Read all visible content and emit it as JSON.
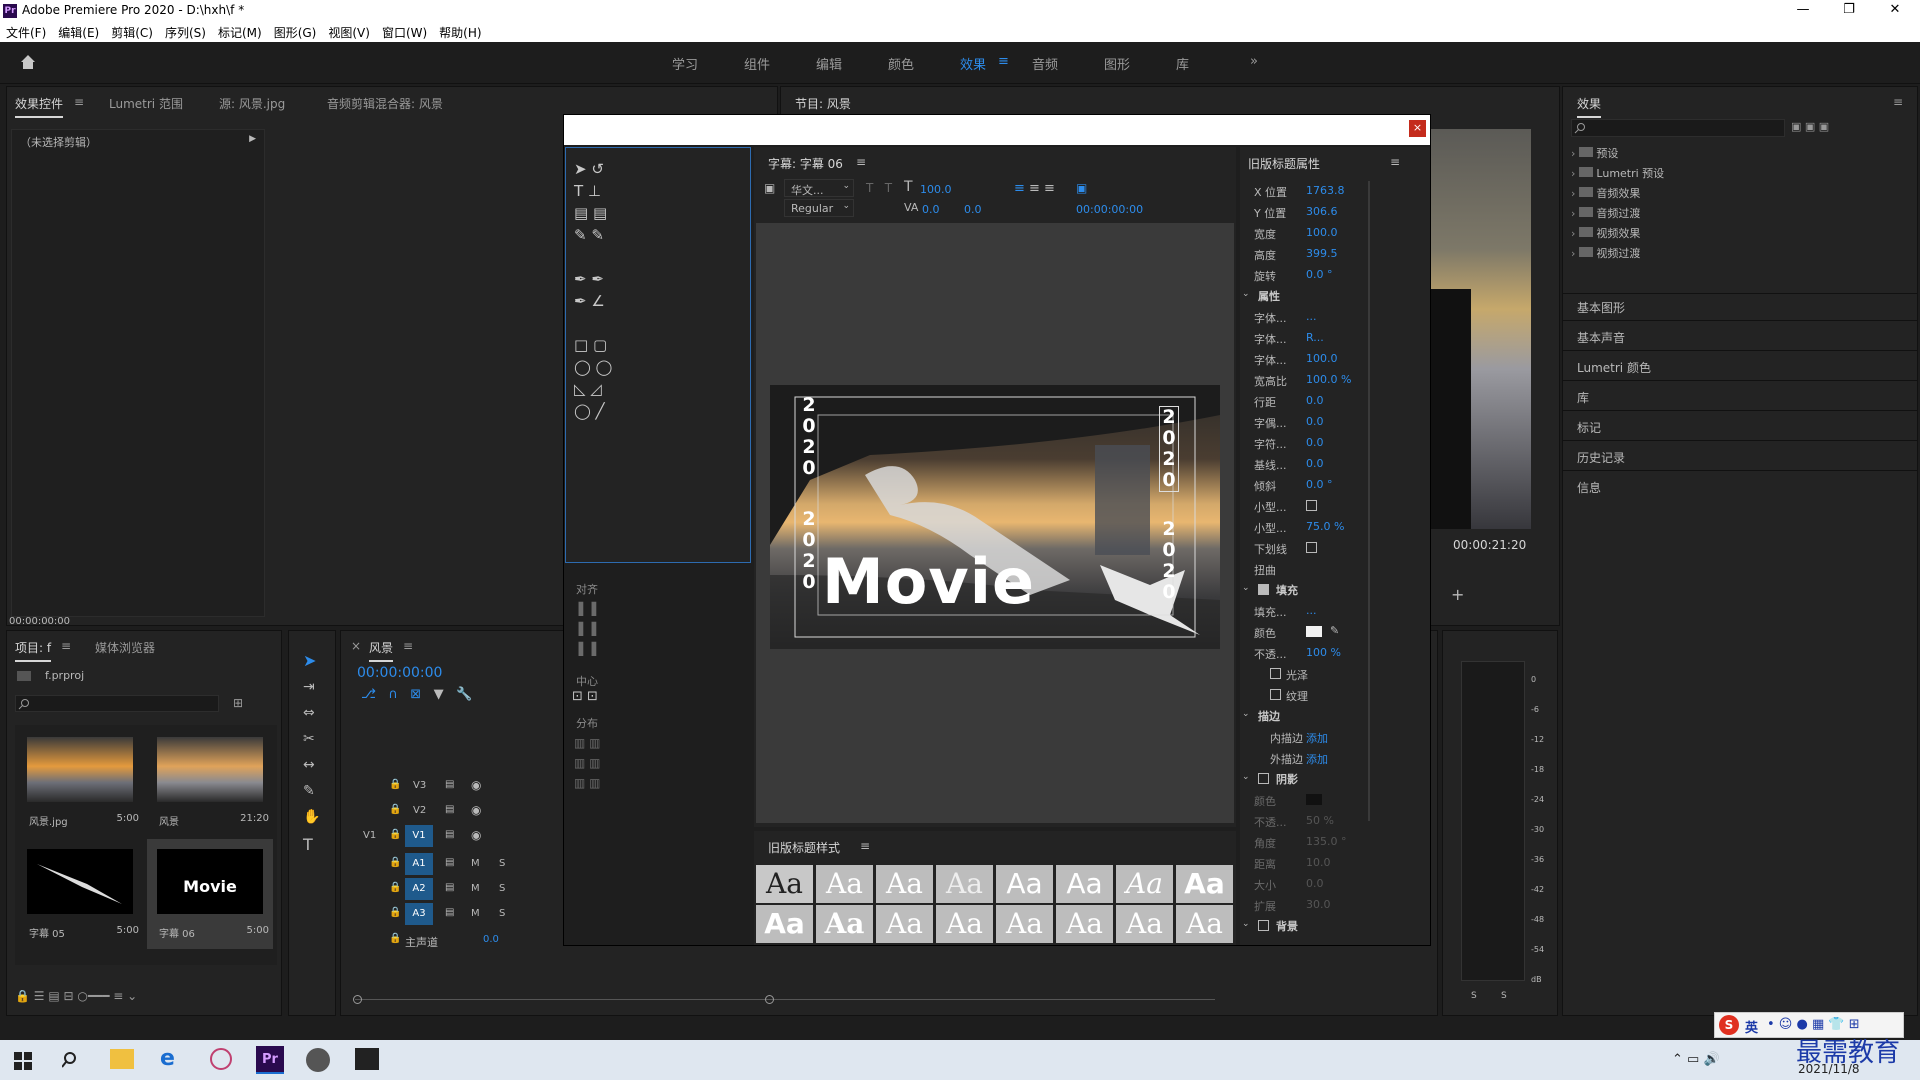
{
  "app": {
    "title": "Adobe Premiere Pro 2020 - D:\\hxh\\f *",
    "logo": "Pr",
    "minimize": "—",
    "maximize": "❐",
    "close": "✕"
  },
  "menu": [
    "文件(F)",
    "编辑(E)",
    "剪辑(C)",
    "序列(S)",
    "标记(M)",
    "图形(G)",
    "视图(V)",
    "窗口(W)",
    "帮助(H)"
  ],
  "workspaces": {
    "tabs": [
      "学习",
      "组件",
      "编辑",
      "颜色",
      "效果",
      "音频",
      "图形",
      "库"
    ],
    "active": "效果",
    "more": "»"
  },
  "effect_controls": {
    "tabs": [
      "效果控件",
      "Lumetri 范围",
      "源: 风景.jpg",
      "音频剪辑混合器: 风景"
    ],
    "no_clip": "（未选择剪辑）",
    "time": "00:00:00:00"
  },
  "program": {
    "tab": "节目: 风景",
    "timecode": "00:00:21:20"
  },
  "effects_panel": {
    "title": "效果",
    "tree": [
      "预设",
      "Lumetri 预设",
      "音频效果",
      "音频过渡",
      "视频效果",
      "视频过渡"
    ],
    "sections": [
      "基本图形",
      "基本声音",
      "Lumetri 颜色",
      "库",
      "标记",
      "历史记录",
      "信息"
    ]
  },
  "project": {
    "tabs": [
      "项目: f",
      "媒体浏览器"
    ],
    "file": "f.prproj",
    "items": [
      {
        "name": "风景.jpg",
        "dur": "5:00"
      },
      {
        "name": "风景",
        "dur": "21:20"
      },
      {
        "name": "字幕 05",
        "dur": "5:00"
      },
      {
        "name": "字幕 06",
        "dur": "5:00"
      }
    ]
  },
  "timeline": {
    "tab": "风景",
    "timecode": "00:00:00:00",
    "tracks": [
      "V3",
      "V2",
      "V1",
      "A1",
      "A2",
      "A3"
    ],
    "source_v1": "V1",
    "master": "主声道",
    "master_val": "0.0",
    "m": "M",
    "s": "S"
  },
  "titler": {
    "title_tab": "字幕: 字幕 06",
    "font": "华文...",
    "style": "Regular",
    "size": "100.0",
    "kern": "0.0",
    "lead": "0.0",
    "tc": "00:00:00:00",
    "align_label": "对齐",
    "center_label": "中心",
    "distribute_label": "分布",
    "styles_title": "旧版标题样式",
    "sample": "Aa",
    "props_title": "旧版标题属性",
    "props": [
      {
        "k": "X 位置",
        "v": "1763.8"
      },
      {
        "k": "Y 位置",
        "v": "306.6"
      },
      {
        "k": "宽度",
        "v": "100.0"
      },
      {
        "k": "高度",
        "v": "399.5"
      },
      {
        "k": "旋转",
        "v": "0.0 °"
      }
    ],
    "attr_title": "属性",
    "attrs": [
      {
        "k": "字体...",
        "v": "..."
      },
      {
        "k": "字体...",
        "v": "R..."
      },
      {
        "k": "字体...",
        "v": "100.0"
      },
      {
        "k": "宽高比",
        "v": "100.0 %"
      },
      {
        "k": "行距",
        "v": "0.0"
      },
      {
        "k": "字偶...",
        "v": "0.0"
      },
      {
        "k": "字符...",
        "v": "0.0"
      },
      {
        "k": "基线...",
        "v": "0.0"
      },
      {
        "k": "倾斜",
        "v": "0.0 °"
      },
      {
        "k": "小型...",
        "v": ""
      },
      {
        "k": "小型...",
        "v": "75.0 %"
      },
      {
        "k": "下划线",
        "v": ""
      },
      {
        "k": "扭曲",
        "v": ""
      }
    ],
    "fill_title": "填充",
    "fill": [
      {
        "k": "填充...",
        "v": "..."
      },
      {
        "k": "颜色",
        "v": ""
      },
      {
        "k": "不透...",
        "v": "100 %"
      },
      {
        "k": "光泽",
        "v": ""
      },
      {
        "k": "纹理",
        "v": ""
      }
    ],
    "stroke_title": "描边",
    "stroke": [
      {
        "k": "内描边",
        "v": "添加"
      },
      {
        "k": "外描边",
        "v": "添加"
      }
    ],
    "shadow_title": "阴影",
    "shadow": [
      {
        "k": "颜色",
        "v": ""
      },
      {
        "k": "不透...",
        "v": "50 %"
      },
      {
        "k": "角度",
        "v": "135.0 °"
      },
      {
        "k": "距离",
        "v": "10.0"
      },
      {
        "k": "大小",
        "v": "0.0"
      },
      {
        "k": "扩展",
        "v": "30.0"
      }
    ],
    "bg_title": "背景",
    "canvas_text": "Movie",
    "year": "2020"
  },
  "meter": {
    "scale": [
      "0",
      "-6",
      "-12",
      "-18",
      "-24",
      "-30",
      "-36",
      "-42",
      "-48",
      "-54",
      "dB"
    ],
    "s": "S"
  },
  "taskbar": {
    "date": "2021/11/8",
    "ime": "英",
    "watermark": "最需教育"
  },
  "colors": {
    "accent": "#2d8ceb",
    "panel": "#232323",
    "bg": "#1d1d1d"
  }
}
